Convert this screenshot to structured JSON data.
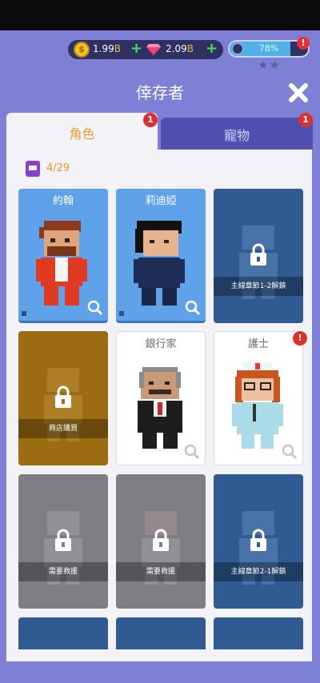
{
  "currency": {
    "coins_value": "1.99",
    "coins_unit": "B",
    "gems_value": "2.09",
    "gems_unit": "B",
    "coin_icon": "coin-icon",
    "gem_icon": "gem-icon",
    "coin_symbol": "$",
    "plus": "+"
  },
  "energy": {
    "label": "78%",
    "fill": 0.78,
    "alert": "!"
  },
  "stars": "★★",
  "title": "倖存者",
  "tabs": [
    {
      "label": "角色",
      "badge": "1",
      "active": true
    },
    {
      "label": "寵物",
      "badge": "1",
      "active": false
    }
  ],
  "roster_count": "4/29",
  "cards": [
    {
      "name": "約翰",
      "state": "unlocked"
    },
    {
      "name": "莉迪婭",
      "state": "unlocked"
    },
    {
      "name": "",
      "state": "locked",
      "lock_text": "主線章節1-2解鎖"
    },
    {
      "name": "",
      "state": "locked",
      "lock_text": "商店購買"
    },
    {
      "name": "銀行家",
      "state": "unlocked"
    },
    {
      "name": "護士",
      "state": "unlocked",
      "alert": "!"
    },
    {
      "name": "",
      "state": "locked",
      "lock_text": "需要救援"
    },
    {
      "name": "",
      "state": "locked",
      "lock_text": "需要救援"
    },
    {
      "name": "",
      "state": "locked",
      "lock_text": "主線章節2-1解鎖"
    }
  ],
  "colors": {
    "background": "#7e80d6",
    "tab_active_text": "#ef9b2d",
    "badge": "#d8322f",
    "card_blue": "#5fa2ea",
    "card_locked_blue": "#2f5a92",
    "card_gold": "#9c6c12",
    "card_grey": "#7e7e83"
  }
}
